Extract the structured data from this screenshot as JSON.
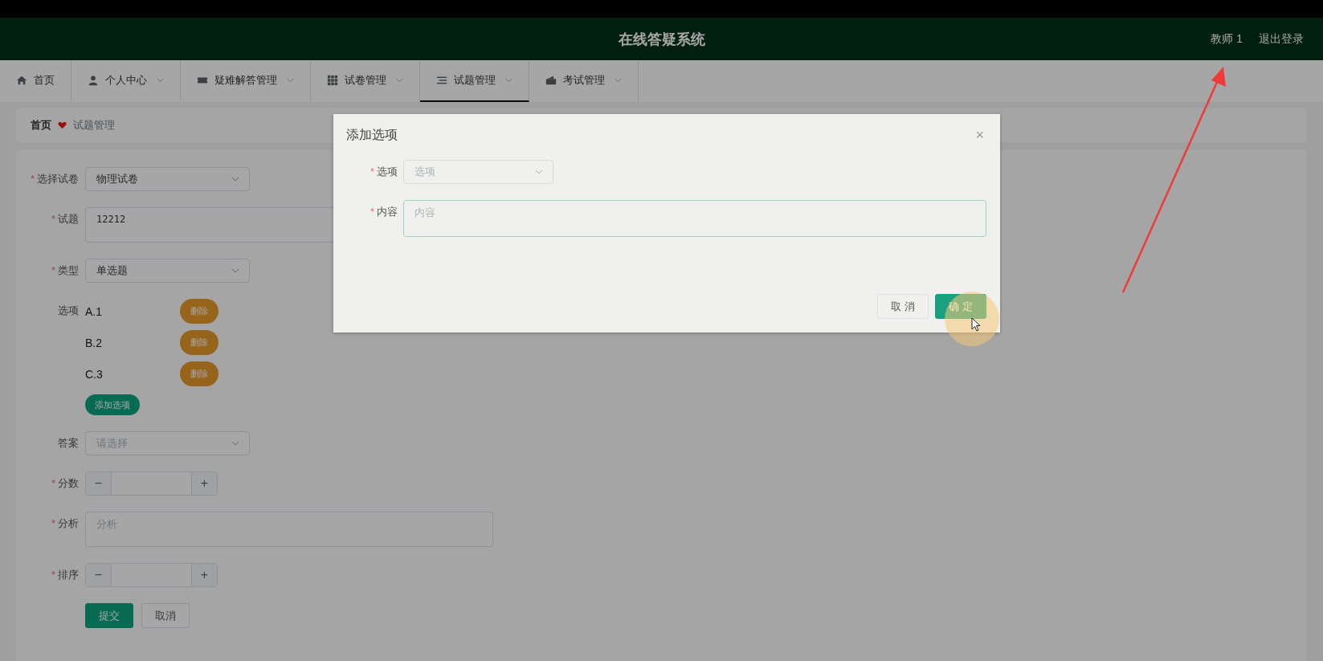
{
  "header": {
    "title": "在线答疑系统",
    "user": "教师 1",
    "logout": "退出登录"
  },
  "nav": [
    {
      "label": "首页",
      "dropdown": false,
      "selected": false
    },
    {
      "label": "个人中心",
      "dropdown": true,
      "selected": false
    },
    {
      "label": "疑难解答管理",
      "dropdown": true,
      "selected": false
    },
    {
      "label": "试卷管理",
      "dropdown": true,
      "selected": false
    },
    {
      "label": "试题管理",
      "dropdown": true,
      "selected": true
    },
    {
      "label": "考试管理",
      "dropdown": true,
      "selected": false
    }
  ],
  "breadcrumb": [
    {
      "label": "首页",
      "current": false
    },
    {
      "label": "试题管理",
      "current": true
    }
  ],
  "form": {
    "rows": [
      {
        "kind": "select",
        "label": "选择试卷",
        "required": "*",
        "value": "物理试卷"
      },
      {
        "kind": "textarea",
        "label": "试题",
        "required": "*",
        "value": "12212"
      },
      {
        "kind": "select",
        "label": "类型",
        "required": "*",
        "value": "单选题"
      },
      {
        "kind": "options",
        "label": "选项",
        "items": [
          {
            "text": "A.1",
            "action": "删除"
          },
          {
            "text": "B.2",
            "action": "删除"
          },
          {
            "text": "C.3",
            "action": "删除"
          }
        ],
        "add": "添加选项"
      },
      {
        "kind": "select",
        "label": "答案",
        "placeholder": "请选择"
      },
      {
        "kind": "number",
        "label": "分数",
        "required": "*",
        "minus": "−",
        "plus": "+"
      },
      {
        "kind": "textarea",
        "label": "分析",
        "required": "*",
        "placeholder": "分析"
      },
      {
        "kind": "number",
        "label": "排序",
        "required": "*",
        "minus": "−",
        "plus": "+"
      }
    ],
    "buttons": [
      {
        "label": "提交",
        "kind": "primary"
      },
      {
        "label": "取消",
        "kind": "default"
      }
    ]
  },
  "dialog": {
    "title": "添加选项",
    "close": "×",
    "fields": [
      {
        "kind": "select",
        "label": "选项",
        "required": "*",
        "placeholder": "选项"
      },
      {
        "kind": "textarea",
        "label": "内容",
        "required": "*",
        "placeholder": "内容"
      }
    ],
    "buttons": [
      {
        "label": "取 消",
        "kind": "default"
      },
      {
        "label": "确 定",
        "kind": "primary"
      }
    ]
  }
}
